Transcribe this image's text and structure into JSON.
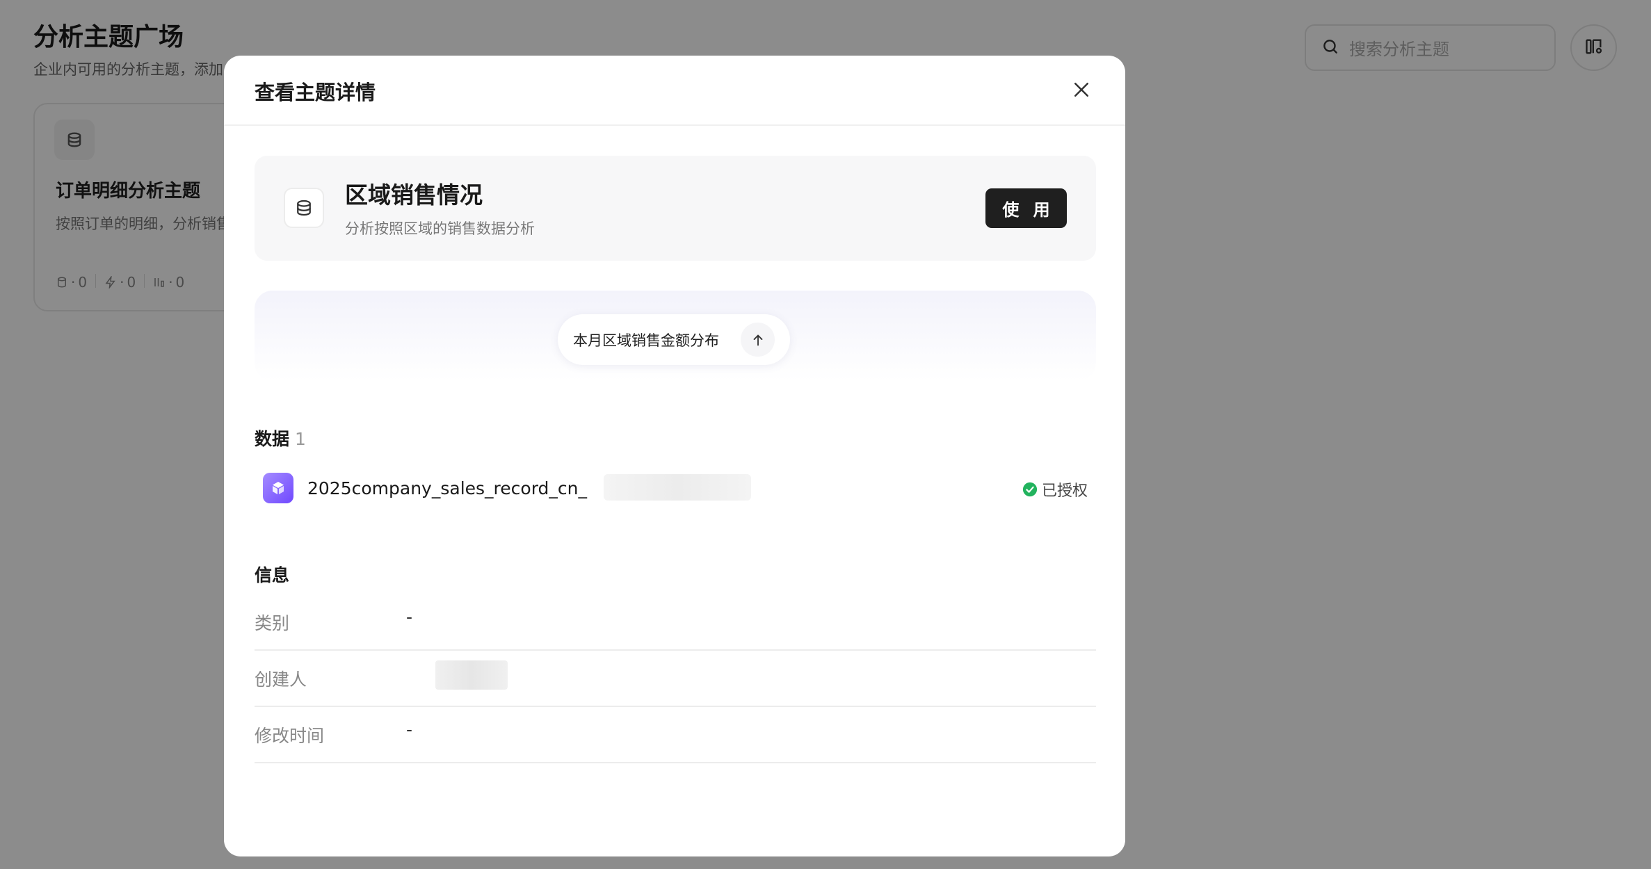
{
  "background": {
    "title": "分析主题广场",
    "subtitle": "企业内可用的分析主题，添加",
    "search_placeholder": "搜索分析主题",
    "card": {
      "title": "订单明细分析主题",
      "description": "按照订单的明细，分析销售",
      "stats": [
        "0",
        "0",
        "0"
      ]
    }
  },
  "modal": {
    "title": "查看主题详情",
    "topic": {
      "name": "区域销售情况",
      "description": "分析按照区域的销售数据分析",
      "use_label": "使 用"
    },
    "prompt": {
      "text": "本月区域销售金额分布"
    },
    "data_section": {
      "label": "数据",
      "count": "1",
      "items": [
        {
          "name": "2025company_sales_record_cn_",
          "status": "已授权"
        }
      ]
    },
    "info_section": {
      "label": "信息",
      "rows": [
        {
          "label": "类别",
          "value": "-"
        },
        {
          "label": "创建人",
          "value": ""
        },
        {
          "label": "修改时间",
          "value": "-"
        }
      ]
    }
  },
  "colors": {
    "overlay": "#000000",
    "primary_button": "#1f1f1f",
    "data_icon": "#7a57ff",
    "authorized": "#22b35e"
  }
}
